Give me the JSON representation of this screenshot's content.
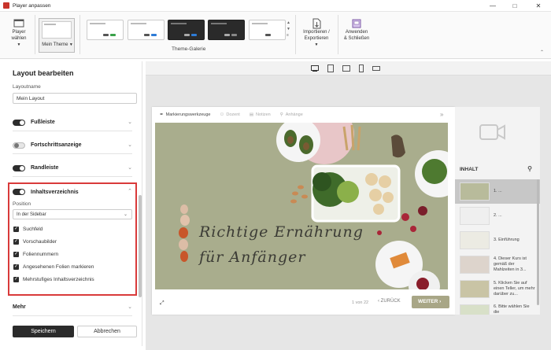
{
  "window": {
    "title": "Player anpassen"
  },
  "ribbon": {
    "player_select_label_1": "Player",
    "player_select_label_2": "wählen",
    "my_theme_label": "Mein Theme",
    "theme_gallery_label": "Theme-Galerie",
    "import_export_label_1": "Importieren /",
    "import_export_label_2": "Exportieren",
    "apply_close_label_1": "Anwenden",
    "apply_close_label_2": "& Schließen"
  },
  "panel": {
    "title": "Layout bearbeiten",
    "layout_name_label": "Layoutname",
    "layout_name_value": "Mein Layout",
    "sections": [
      {
        "label": "Fußleiste",
        "on": true
      },
      {
        "label": "Fortschrittsanzeige",
        "on": false
      },
      {
        "label": "Randleiste",
        "on": true
      },
      {
        "label": "Inhaltsverzeichnis",
        "on": true
      }
    ],
    "position_label": "Position",
    "position_value": "In der Sidebar",
    "checkboxes": [
      "Suchfeld",
      "Vorschaubilder",
      "Foliennummern",
      "Angesehenen Folien markieren",
      "Mehrstufiges Inhaltsverzeichnis"
    ],
    "more_label": "Mehr",
    "save_label": "Speichern",
    "cancel_label": "Abbrechen"
  },
  "player": {
    "toolbar": [
      "Markierungswerkzeuge",
      "Dozent",
      "Notizen",
      "Anhänge"
    ],
    "slide_title_1": "Richtige Ernährung",
    "slide_title_2": "für Anfänger",
    "page_counter": "1 von 22",
    "back_label": "ZURÜCK",
    "next_label": "WEITER",
    "sidebar_heading": "INHALT",
    "sidebar_items": [
      {
        "label": "1. ..."
      },
      {
        "label": "2. ..."
      },
      {
        "label": "3. Einführung"
      },
      {
        "label": "4. Dieser Kurs ist gemäß der Mahlzeiten in 3..."
      },
      {
        "label": "5. Klicken Sie auf einen Teller, um mehr darüber zu..."
      },
      {
        "label": "6. Bitte wählen Sie die"
      }
    ]
  },
  "colors": {
    "accent": "#d93a3a",
    "slide_bg": "#a9ad8d",
    "next_button": "#a8a686"
  }
}
